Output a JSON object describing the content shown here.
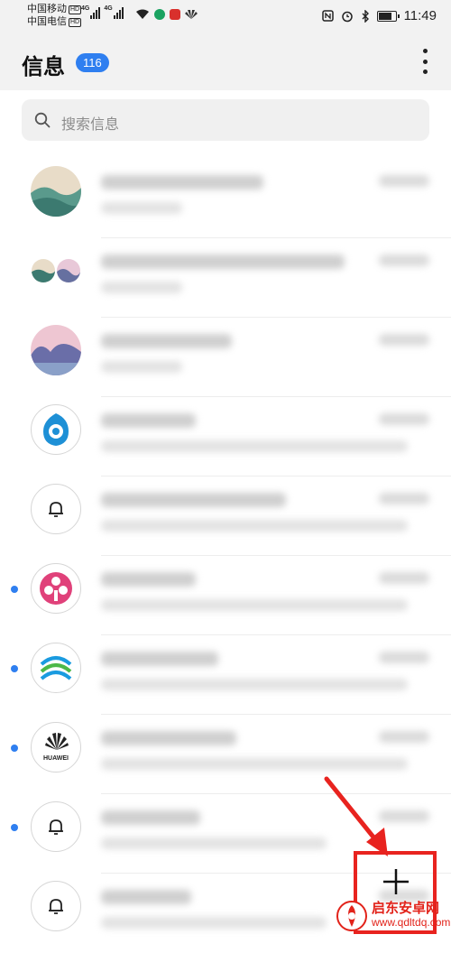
{
  "status_bar": {
    "carrier1": "中国移动",
    "carrier2": "中国电信",
    "hd": "HD",
    "net1": "4G",
    "net2": "4G",
    "time": "11:49"
  },
  "header": {
    "title": "信息",
    "unread_count": "116"
  },
  "search": {
    "placeholder": "搜索信息"
  },
  "conversations": [
    {
      "avatar": "landscape-green",
      "unread": false
    },
    {
      "avatar": "group-landscape",
      "unread": false
    },
    {
      "avatar": "landscape-pink",
      "unread": false
    },
    {
      "avatar": "blue-logo",
      "unread": false
    },
    {
      "avatar": "bell",
      "unread": false
    },
    {
      "avatar": "pink-flower",
      "unread": true
    },
    {
      "avatar": "china-mobile",
      "unread": true
    },
    {
      "avatar": "huawei",
      "unread": true,
      "avatar_text": "HUAWEI"
    },
    {
      "avatar": "bell",
      "unread": true
    },
    {
      "avatar": "bell",
      "unread": false
    }
  ],
  "fab": {
    "icon": "plus-icon"
  },
  "watermark": {
    "name": "启东安卓网",
    "url": "www.qdltdq.com"
  },
  "colors": {
    "accent": "#2f7ff0",
    "highlight": "#e8231f",
    "background": "#ffffff",
    "header_bg": "#f2f2f2"
  }
}
